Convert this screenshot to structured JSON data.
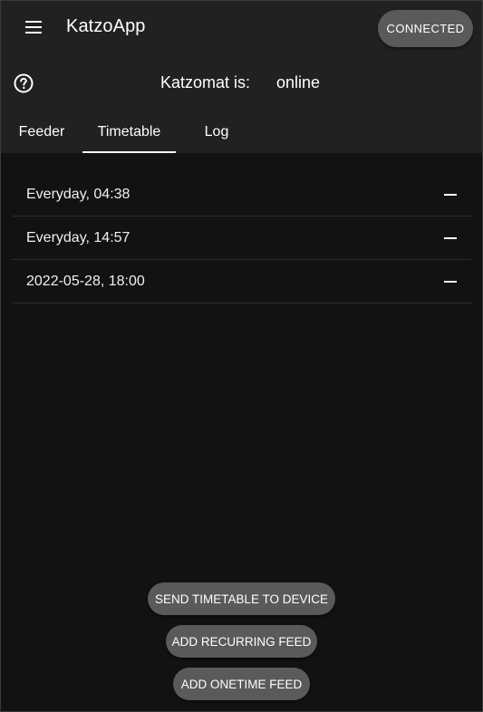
{
  "appbar": {
    "title": "KatzoApp",
    "menu_icon": "menu-icon",
    "connection_label": "CONNECTED"
  },
  "status": {
    "help_icon": "help-circle-icon",
    "label": "Katzomat is:",
    "value": "online"
  },
  "tabs": [
    {
      "label": "Feeder",
      "active": false
    },
    {
      "label": "Timetable",
      "active": true
    },
    {
      "label": "Log",
      "active": false
    }
  ],
  "timetable": {
    "entries": [
      {
        "label": "Everyday, 04:38",
        "action_icon": "minus-icon"
      },
      {
        "label": "Everyday, 14:57",
        "action_icon": "minus-icon"
      },
      {
        "label": "2022-05-28, 18:00",
        "action_icon": "minus-icon"
      }
    ]
  },
  "actions": {
    "send_label": "SEND TIMETABLE TO DEVICE",
    "add_recurring_label": "ADD RECURRING FEED",
    "add_onetime_label": "ADD ONETIME FEED"
  },
  "colors": {
    "background": "#121212",
    "bar": "#212121",
    "button": "#5a5a5a",
    "text": "#ffffff"
  }
}
